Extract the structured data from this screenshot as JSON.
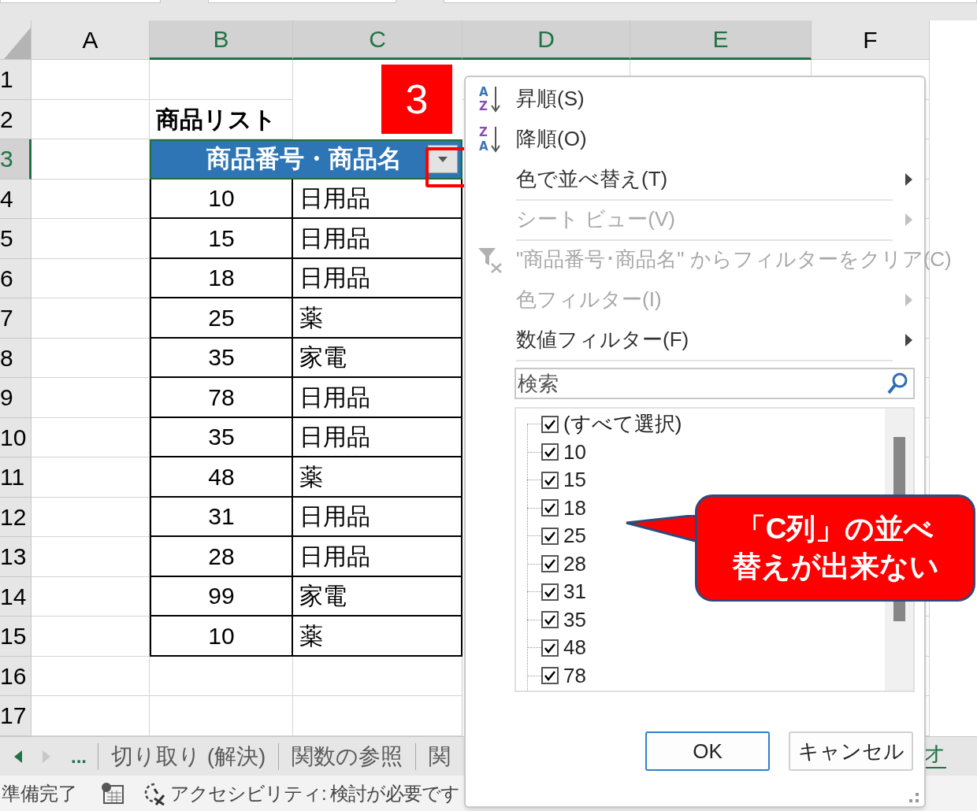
{
  "columns": [
    {
      "label": "A",
      "selected": false
    },
    {
      "label": "B",
      "selected": true
    },
    {
      "label": "C",
      "selected": true
    },
    {
      "label": "D",
      "selected": true
    },
    {
      "label": "E",
      "selected": true
    },
    {
      "label": "F",
      "selected": false
    }
  ],
  "rows": [
    {
      "label": "1",
      "selected": false
    },
    {
      "label": "2",
      "selected": false
    },
    {
      "label": "3",
      "selected": true
    },
    {
      "label": "4",
      "selected": false
    },
    {
      "label": "5",
      "selected": false
    },
    {
      "label": "6",
      "selected": false
    },
    {
      "label": "7",
      "selected": false
    },
    {
      "label": "8",
      "selected": false
    },
    {
      "label": "9",
      "selected": false
    },
    {
      "label": "10",
      "selected": false
    },
    {
      "label": "11",
      "selected": false
    },
    {
      "label": "12",
      "selected": false
    },
    {
      "label": "13",
      "selected": false
    },
    {
      "label": "14",
      "selected": false
    },
    {
      "label": "15",
      "selected": false
    },
    {
      "label": "16",
      "selected": false
    },
    {
      "label": "17",
      "selected": false
    }
  ],
  "sheet": {
    "title": "商品リスト",
    "table_header": "商品番号・商品名",
    "table_rows": [
      {
        "number": "10",
        "name": "日用品"
      },
      {
        "number": "15",
        "name": "日用品"
      },
      {
        "number": "18",
        "name": "日用品"
      },
      {
        "number": "25",
        "name": "薬"
      },
      {
        "number": "35",
        "name": "家電"
      },
      {
        "number": "78",
        "name": "日用品"
      },
      {
        "number": "35",
        "name": "日用品"
      },
      {
        "number": "48",
        "name": "薬"
      },
      {
        "number": "31",
        "name": "日用品"
      },
      {
        "number": "28",
        "name": "日用品"
      },
      {
        "number": "99",
        "name": "家電"
      },
      {
        "number": "10",
        "name": "薬"
      }
    ]
  },
  "step_badge": "3",
  "filter_menu": {
    "items": [
      {
        "kind": "sort-asc",
        "icon_letters": [
          "A",
          "Z"
        ],
        "label": "昇順(S)",
        "disabled": false,
        "submenu": false,
        "separator_after": false
      },
      {
        "kind": "sort-desc",
        "icon_letters": [
          "Z",
          "A"
        ],
        "label": "降順(O)",
        "disabled": false,
        "submenu": false,
        "separator_after": false
      },
      {
        "kind": "plain",
        "label": "色で並べ替え(T)",
        "disabled": false,
        "submenu": true,
        "separator_after": true
      },
      {
        "kind": "plain",
        "label": "シート ビュー(V)",
        "disabled": true,
        "submenu": true,
        "separator_after": true
      },
      {
        "kind": "clear-filter",
        "label": "\"商品番号･商品名\" からフィルターをクリア(C)",
        "disabled": true,
        "submenu": false,
        "separator_after": false
      },
      {
        "kind": "plain",
        "label": "色フィルター(I)",
        "disabled": true,
        "submenu": true,
        "separator_after": false
      },
      {
        "kind": "plain",
        "label": "数値フィルター(F)",
        "disabled": false,
        "submenu": true,
        "separator_after": true
      }
    ],
    "search": {
      "placeholder": "検索"
    },
    "values": [
      {
        "label": "(すべて選択)",
        "checked": true
      },
      {
        "label": "10",
        "checked": true
      },
      {
        "label": "15",
        "checked": true
      },
      {
        "label": "18",
        "checked": true
      },
      {
        "label": "25",
        "checked": true
      },
      {
        "label": "28",
        "checked": true
      },
      {
        "label": "31",
        "checked": true
      },
      {
        "label": "35",
        "checked": true
      },
      {
        "label": "48",
        "checked": true
      },
      {
        "label": "78",
        "checked": true
      }
    ],
    "buttons": [
      {
        "label": "OK",
        "kind": "primary"
      },
      {
        "label": "キャンセル",
        "kind": "secondary"
      }
    ]
  },
  "callout": {
    "lines": [
      "「C列」の並べ",
      "替えが出来ない"
    ]
  },
  "sheet_tabs": {
    "more": "...",
    "tabs": [
      {
        "label": "切り取り (解決)",
        "selected": false
      },
      {
        "label": "関数の参照",
        "selected": false
      },
      {
        "label": "関",
        "selected": false
      },
      {
        "label": "オ",
        "selected": true
      }
    ]
  },
  "status_bar": {
    "ready": "準備完了",
    "accessibility": "アクセシビリティ: 検討が必要です"
  }
}
